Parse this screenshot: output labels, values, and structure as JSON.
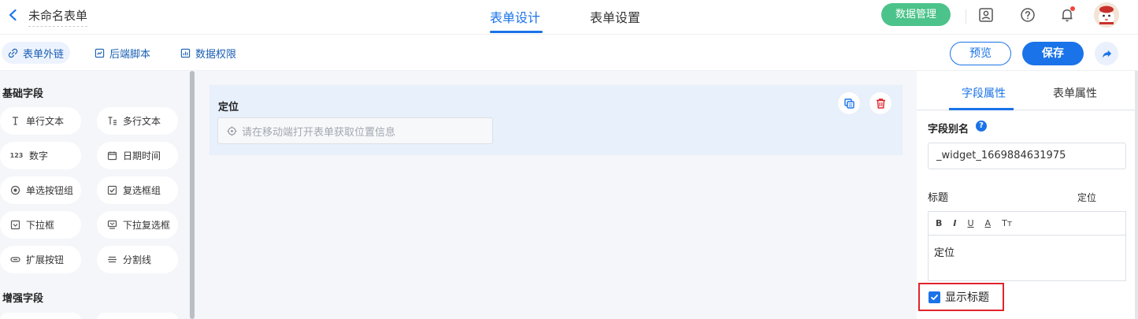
{
  "header": {
    "form_name": "未命名表单",
    "tabs": [
      {
        "label": "表单设计",
        "active": true
      },
      {
        "label": "表单设置",
        "active": false
      }
    ],
    "data_mgmt_label": "数据管理",
    "icons": [
      "contact-card-icon",
      "help-icon",
      "bell-icon",
      "avatar"
    ]
  },
  "toolbar": {
    "items": [
      {
        "label": "表单外链",
        "icon": "link-icon",
        "active": true
      },
      {
        "label": "后端脚本",
        "icon": "script-icon",
        "active": false
      },
      {
        "label": "数据权限",
        "icon": "permission-icon",
        "active": false
      }
    ],
    "preview_label": "预览",
    "save_label": "保存"
  },
  "palette": {
    "basic_title": "基础字段",
    "fields": [
      {
        "label": "单行文本",
        "icon": "text-cursor-icon"
      },
      {
        "label": "多行文本",
        "icon": "multiline-text-icon"
      },
      {
        "label": "数字",
        "icon": "number-icon",
        "glyph": "123"
      },
      {
        "label": "日期时间",
        "icon": "calendar-icon"
      },
      {
        "label": "单选按钮组",
        "icon": "radio-icon"
      },
      {
        "label": "复选框组",
        "icon": "checkbox-group-icon"
      },
      {
        "label": "下拉框",
        "icon": "dropdown-icon"
      },
      {
        "label": "下拉复选框",
        "icon": "dropdown-multi-icon"
      },
      {
        "label": "扩展按钮",
        "icon": "extend-button-icon"
      },
      {
        "label": "分割线",
        "icon": "divider-icon"
      }
    ],
    "advanced_title": "增强字段"
  },
  "canvas": {
    "widget_label": "定位",
    "widget_placeholder": "请在移动端打开表单获取位置信息"
  },
  "props": {
    "tabs": [
      {
        "label": "字段属性",
        "active": true
      },
      {
        "label": "表单属性",
        "active": false
      }
    ],
    "alias_label": "字段别名",
    "alias_value": "_widget_1669884631975",
    "title_label": "标题",
    "title_value": "定位",
    "rte_buttons": [
      "B",
      "I",
      "U",
      "A",
      "Tт"
    ],
    "rte_content": "定位",
    "show_title_label": "显示标题",
    "show_title_checked": true
  },
  "colors": {
    "accent": "#1a73e8",
    "success": "#4cc38a",
    "danger": "#e0242b"
  }
}
